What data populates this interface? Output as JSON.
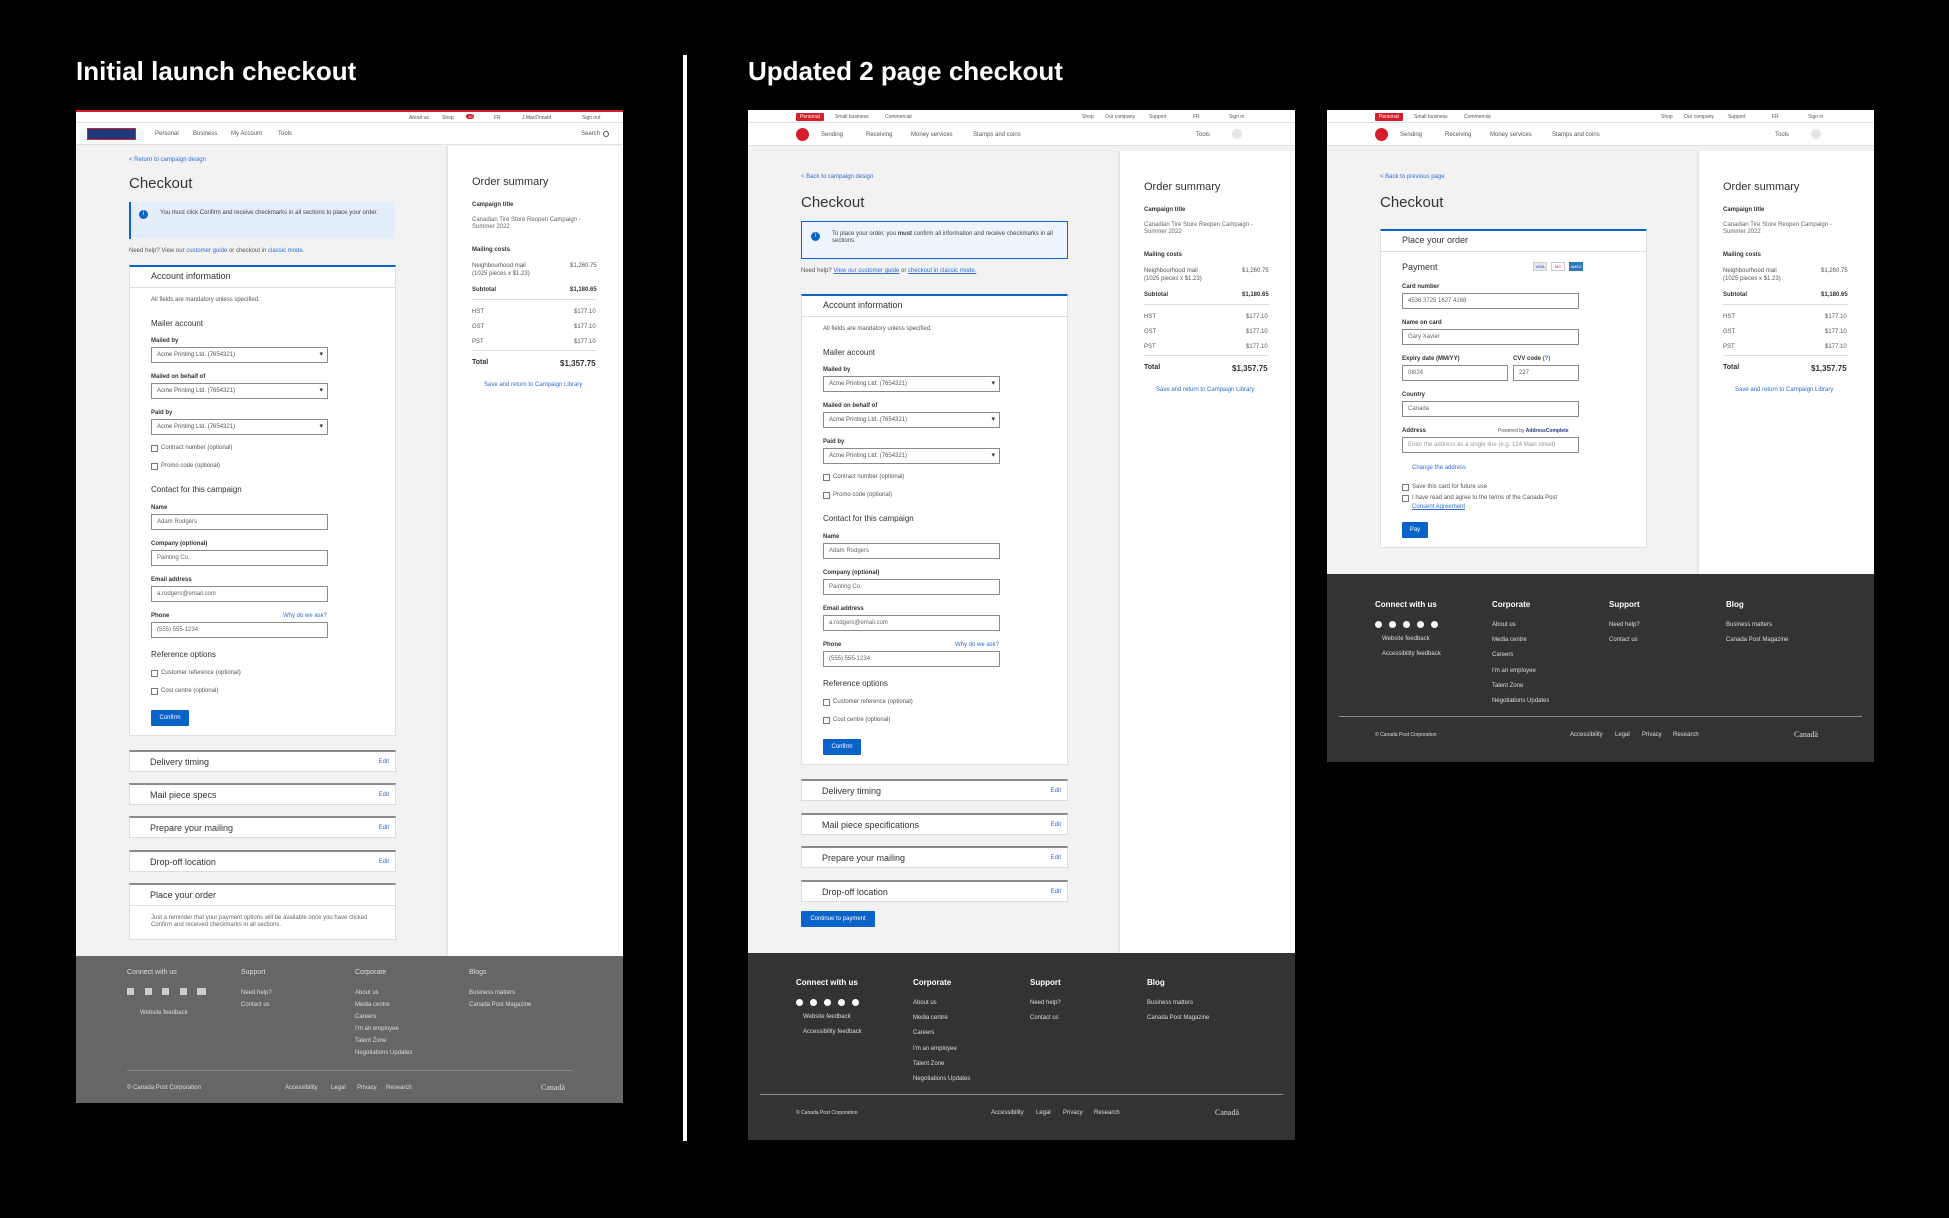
{
  "headings": {
    "left": "Initial launch checkout",
    "right": "Updated 2 page checkout"
  },
  "v1": {
    "top": {
      "about": "About us",
      "shop": "Shop",
      "cart_count": "10",
      "fr": "FR",
      "user": "J.MacDonald",
      "signout": "Sign out"
    },
    "nav": {
      "personal": "Personal",
      "business": "Business",
      "account": "My Account",
      "tools": "Tools",
      "search": "Search"
    },
    "back": "< Return to campaign design",
    "title": "Checkout",
    "notice": "You must click Confirm and receive checkmarks in all sections to place your order.",
    "help_pre": "Need help? View our",
    "help_link1": "customer guide",
    "help_mid": "or checkout in",
    "help_link2": "classic mode.",
    "account_title": "Account information",
    "mandatory": "All fields are mandatory unless specified.",
    "mailer": "Mailer account",
    "mailed_by": "Mailed by",
    "mailed_on_behalf": "Mailed on behalf of",
    "paid_by": "Paid by",
    "acct_value": "Acme Printing Ltd. (7654321)",
    "contract": "Contract number (optional)",
    "promo": "Promo code (optional)",
    "contact": "Contact for this campaign",
    "name_lbl": "Name",
    "name_val": "Adam Rodgers",
    "company_lbl": "Company (optional)",
    "company_val": "Painting Co.",
    "email_lbl": "Email address",
    "email_val": "a.rodgers@email.com",
    "phone_lbl": "Phone",
    "phone_why": "Why do we ask?",
    "phone_val": "(555) 555-1234",
    "ref": "Reference options",
    "cust_ref": "Customer reference (optional)",
    "cost": "Cost centre (optional)",
    "confirm": "Confirm",
    "sections": [
      "Delivery timing",
      "Mail piece specs",
      "Prepare your mailing",
      "Drop-off location"
    ],
    "edit": "Edit",
    "place_title": "Place your order",
    "place_text": "Just a reminder that your payment options will be available once you have clicked Confirm and received checkmarks in all sections.",
    "summary": {
      "title": "Order summary",
      "campaign_lbl": "Campaign title",
      "campaign": "Canadian Tire Store Reopen Campaign - Summer 2022",
      "mailing": "Mailing costs",
      "nm": "Neighbourhood mail",
      "nm_detail": "(1025 pieces x $1.23)",
      "nm_val": "$1,260.75",
      "subtotal": "Subtotal",
      "subtotal_val": "$1,180.65",
      "hst": "HST",
      "gst": "GST",
      "pst": "PST",
      "tax_val": "$177.10",
      "total": "Total",
      "total_val": "$1,357.75",
      "save": "Save and return to Campaign Library"
    },
    "footer": {
      "connect": "Connect with us",
      "feedback": "Website feedback",
      "support": "Support",
      "need_help": "Need help?",
      "contact": "Contact us",
      "corporate": "Corporate",
      "corp": [
        "About us",
        "Media centre",
        "Careers",
        "I'm an employee",
        "Talent Zone",
        "Negotiations Updates"
      ],
      "blogs": "Blogs",
      "blog_items": [
        "Business matters",
        "Canada Post Magazine"
      ],
      "copyright": "© Canada Post Corporation",
      "legal": [
        "Accessibility",
        "Legal",
        "Privacy",
        "Research"
      ],
      "canada": "Canadä"
    }
  },
  "v2": {
    "top": {
      "personal": "Personal",
      "small": "Small business",
      "commercial": "Commercial",
      "shop": "Shop",
      "company": "Our company",
      "support": "Support",
      "fr": "FR",
      "signin": "Sign in"
    },
    "nav": {
      "sending": "Sending",
      "receiving": "Receiving",
      "money": "Money services",
      "stamps": "Stamps and coins",
      "tools": "Tools"
    },
    "back": "< Back to campaign design",
    "title": "Checkout",
    "notice_pre": "To place your order, you ",
    "notice_bold": "must",
    "notice_post": " confirm all information and receive checkmarks in all sections.",
    "help_pre": "Need help?",
    "help_link1": "View our customer guide",
    "help_mid": "or",
    "help_link2": "checkout in classic mode.",
    "sections": [
      "Delivery timing",
      "Mail piece specifications",
      "Prepare your mailing",
      "Drop-off location"
    ],
    "continue": "Continue to payment",
    "footer": {
      "connect": "Connect with us",
      "feedback": "Website feedback",
      "access": "Accessibility feedback",
      "corporate": "Corporate",
      "support": "Support",
      "need_help": "Need help?",
      "contact": "Contact us",
      "blog": "Blog",
      "copyright": "© Canada Post Corporation",
      "canada": "Canadä"
    }
  },
  "v3": {
    "back": "< Back to previous page",
    "title": "Checkout",
    "place": "Place your order",
    "payment": "Payment",
    "card_lbl": "Card number",
    "card_val": "4536 3725 1627 4268",
    "name_lbl": "Name on card",
    "name_val": "Gary Xavier",
    "exp_lbl": "Expiry date (MM/YY)",
    "exp_val": "08/24",
    "cvv_lbl": "CVV code",
    "cvv_q": "(?)",
    "cvv_val": "227",
    "country_lbl": "Country",
    "country_val": "Canada",
    "addr_lbl": "Address",
    "powered": "Powered by",
    "ac": "AddressComplete",
    "addr_ph": "Enter the address as a single line (e.g. 124 Main street)",
    "change": "Change the address",
    "save_card": "Save this card for future use",
    "terms": "I have read and agree to the terms of the Canada Post",
    "consent": "Consent Agreement",
    "pay": "Pay",
    "cards": [
      "VISA",
      "MC",
      "AMEX"
    ]
  }
}
